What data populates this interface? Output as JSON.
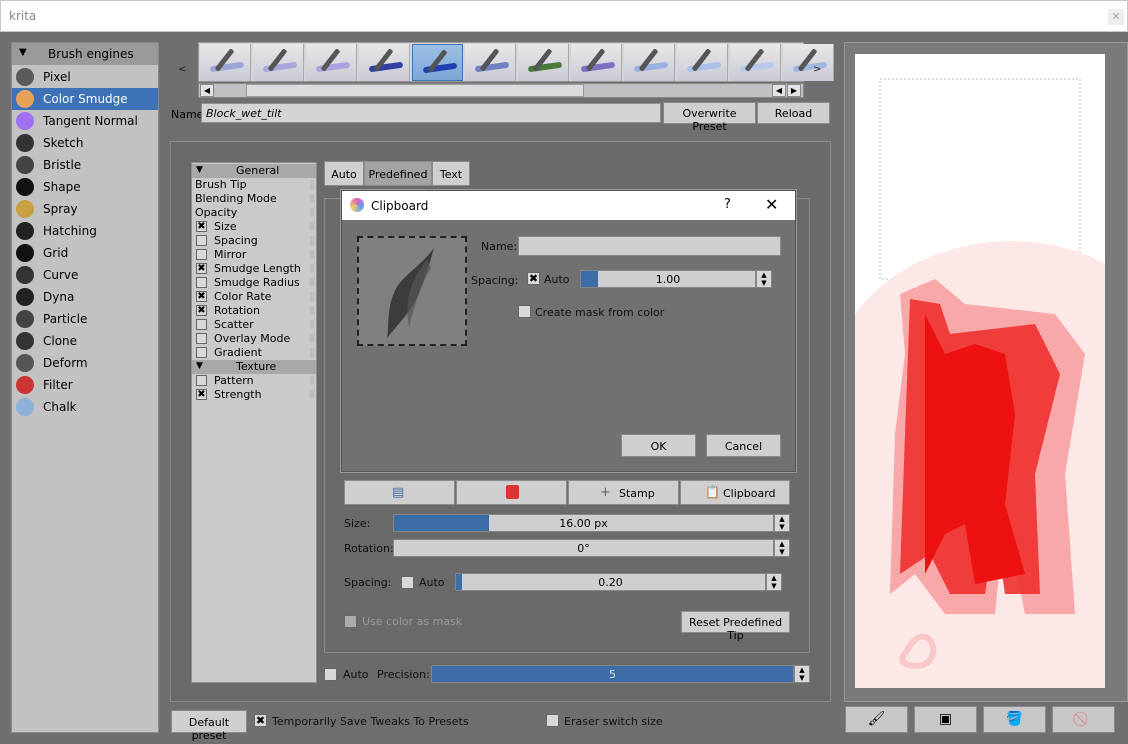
{
  "window": {
    "title": "krita",
    "close": "✕"
  },
  "engines": {
    "header": "Brush engines",
    "items": [
      {
        "label": "Pixel",
        "icon": "pixel-brush-icon",
        "color": "#5a5a5a"
      },
      {
        "label": "Color Smudge",
        "icon": "color-smudge-icon",
        "color": "#e8a15a",
        "selected": true
      },
      {
        "label": "Tangent Normal",
        "icon": "tangent-normal-icon",
        "color": "#a070f0"
      },
      {
        "label": "Sketch",
        "icon": "sketch-icon",
        "color": "#333333"
      },
      {
        "label": "Bristle",
        "icon": "bristle-icon",
        "color": "#444444"
      },
      {
        "label": "Shape",
        "icon": "shape-icon",
        "color": "#111111"
      },
      {
        "label": "Spray",
        "icon": "spray-icon",
        "color": "#c8a040"
      },
      {
        "label": "Hatching",
        "icon": "hatching-icon",
        "color": "#222222"
      },
      {
        "label": "Grid",
        "icon": "grid-icon",
        "color": "#111111"
      },
      {
        "label": "Curve",
        "icon": "curve-icon",
        "color": "#333333"
      },
      {
        "label": "Dyna",
        "icon": "dyna-icon",
        "color": "#222222"
      },
      {
        "label": "Particle",
        "icon": "particle-icon",
        "color": "#444444"
      },
      {
        "label": "Clone",
        "icon": "clone-icon",
        "color": "#333333"
      },
      {
        "label": "Deform",
        "icon": "deform-icon",
        "color": "#555555"
      },
      {
        "label": "Filter",
        "icon": "filter-icon",
        "color": "#cc3333"
      },
      {
        "label": "Chalk",
        "icon": "chalk-icon",
        "color": "#8fb0d8"
      }
    ]
  },
  "presets": {
    "nav_left": "<",
    "nav_right": ">",
    "thumbs": [
      {
        "stroke": "#9aa6d8"
      },
      {
        "stroke": "#a8a6dc"
      },
      {
        "stroke": "#b0a0e0"
      },
      {
        "stroke": "#3040a0"
      },
      {
        "stroke": "#2040b0",
        "selected": true
      },
      {
        "stroke": "#7080c0"
      },
      {
        "stroke": "#4a7a3a"
      },
      {
        "stroke": "#7a70c0"
      },
      {
        "stroke": "#9ab0e0"
      },
      {
        "stroke": "#aac0e8"
      },
      {
        "stroke": "#b8c8ea"
      },
      {
        "stroke": "#a0b8e0"
      }
    ]
  },
  "name_row": {
    "label": "Name:",
    "value": "Block_wet_tilt",
    "overwrite": "Overwrite Preset",
    "reload": "Reload"
  },
  "options": {
    "groups": [
      {
        "name": "General",
        "items": [
          {
            "label": "Brush Tip",
            "checkbox": false
          },
          {
            "label": "Blending Mode",
            "checkbox": false
          },
          {
            "label": "Opacity",
            "checkbox": false
          },
          {
            "label": "Size",
            "checkbox": true,
            "checked": true
          },
          {
            "label": "Spacing",
            "checkbox": true,
            "checked": false
          },
          {
            "label": "Mirror",
            "checkbox": true,
            "checked": false
          },
          {
            "label": "Smudge Length",
            "checkbox": true,
            "checked": true
          },
          {
            "label": "Smudge Radius",
            "checkbox": true,
            "checked": false
          },
          {
            "label": "Color Rate",
            "checkbox": true,
            "checked": true
          },
          {
            "label": "Rotation",
            "checkbox": true,
            "checked": true
          },
          {
            "label": "Scatter",
            "checkbox": true,
            "checked": false
          },
          {
            "label": "Overlay Mode",
            "checkbox": true,
            "checked": false
          },
          {
            "label": "Gradient",
            "checkbox": true,
            "checked": false
          }
        ]
      },
      {
        "name": "Texture",
        "items": [
          {
            "label": "Pattern",
            "checkbox": true,
            "checked": false
          },
          {
            "label": "Strength",
            "checkbox": true,
            "checked": true
          }
        ]
      }
    ]
  },
  "tip_tabs": [
    "Auto",
    "Predefined",
    "Text"
  ],
  "tip_buttons": {
    "stamp": "Stamp",
    "clipboard": "Clipboard"
  },
  "size": {
    "label": "Size:",
    "value": "16.00 px",
    "fraction": 0.25
  },
  "rotation": {
    "label": "Rotation:",
    "value": "0°",
    "fraction": 0.0
  },
  "spacing": {
    "label": "Spacing:",
    "auto_label": "Auto",
    "value": "0.20",
    "fraction": 0.02
  },
  "use_color_mask": "Use color as mask",
  "reset_tip": "Reset Predefined Tip",
  "precision": {
    "auto_label": "Auto",
    "label": "Precision:",
    "value": "5",
    "fraction": 1.0
  },
  "footer": {
    "default_preset": "Default preset",
    "temp_save": "Temporarily Save Tweaks To Presets",
    "eraser_switch": "Eraser switch size"
  },
  "dialog": {
    "title": "Clipboard",
    "help": "?",
    "close": "✕",
    "name_label": "Name:",
    "name_value": "",
    "spacing_label": "Spacing:",
    "auto_label": "Auto",
    "spacing_value": "1.00",
    "spacing_fraction": 0.1,
    "mask_label": "Create mask from color",
    "ok": "OK",
    "cancel": "Cancel"
  },
  "bottom_tools": [
    {
      "icon": "brush-icon",
      "glyph": "🖌"
    },
    {
      "icon": "gradient-icon",
      "glyph": "▣"
    },
    {
      "icon": "fill-bucket-icon",
      "glyph": "🪣"
    },
    {
      "icon": "no-entry-icon",
      "glyph": "⃠"
    }
  ]
}
